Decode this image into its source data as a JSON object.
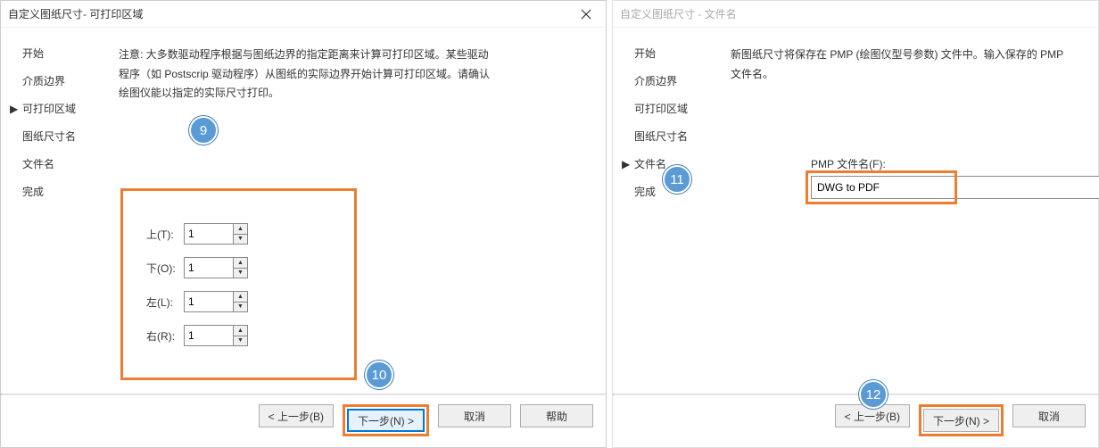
{
  "left": {
    "title": "自定义图纸尺寸- 可打印区域",
    "sidebar": [
      "开始",
      "介质边界",
      "可打印区域",
      "图纸尺寸名",
      "文件名",
      "完成"
    ],
    "active_index": 2,
    "description": "注意: 大多数驱动程序根据与图纸边界的指定距离来计算可打印区域。某些驱动程序（如 Postscrip 驱动程序）从图纸的实际边界开始计算可打印区域。请确认绘图仪能以指定的实际尺寸打印。",
    "fields": [
      {
        "label": "上(T):",
        "value": "1"
      },
      {
        "label": "下(O):",
        "value": "1"
      },
      {
        "label": "左(L):",
        "value": "1"
      },
      {
        "label": "右(R):",
        "value": "1"
      }
    ],
    "buttons": {
      "back": "< 上一步(B)",
      "next": "下一步(N) >",
      "cancel": "取消",
      "help": "帮助"
    }
  },
  "right": {
    "title": "自定义图纸尺寸 - 文件名",
    "sidebar": [
      "开始",
      "介质边界",
      "可打印区域",
      "图纸尺寸名",
      "文件名",
      "完成"
    ],
    "active_index": 4,
    "description": "新图纸尺寸将保存在 PMP (绘图仪型号参数) 文件中。输入保存的 PMP 文件名。",
    "filename_label": "PMP 文件名(F):",
    "filename_value": "DWG to PDF",
    "buttons": {
      "back": "< 上一步(B)",
      "next": "下一步(N) >",
      "cancel": "取消"
    }
  },
  "badges": {
    "b9": "9",
    "b10": "10",
    "b11": "11",
    "b12": "12"
  }
}
